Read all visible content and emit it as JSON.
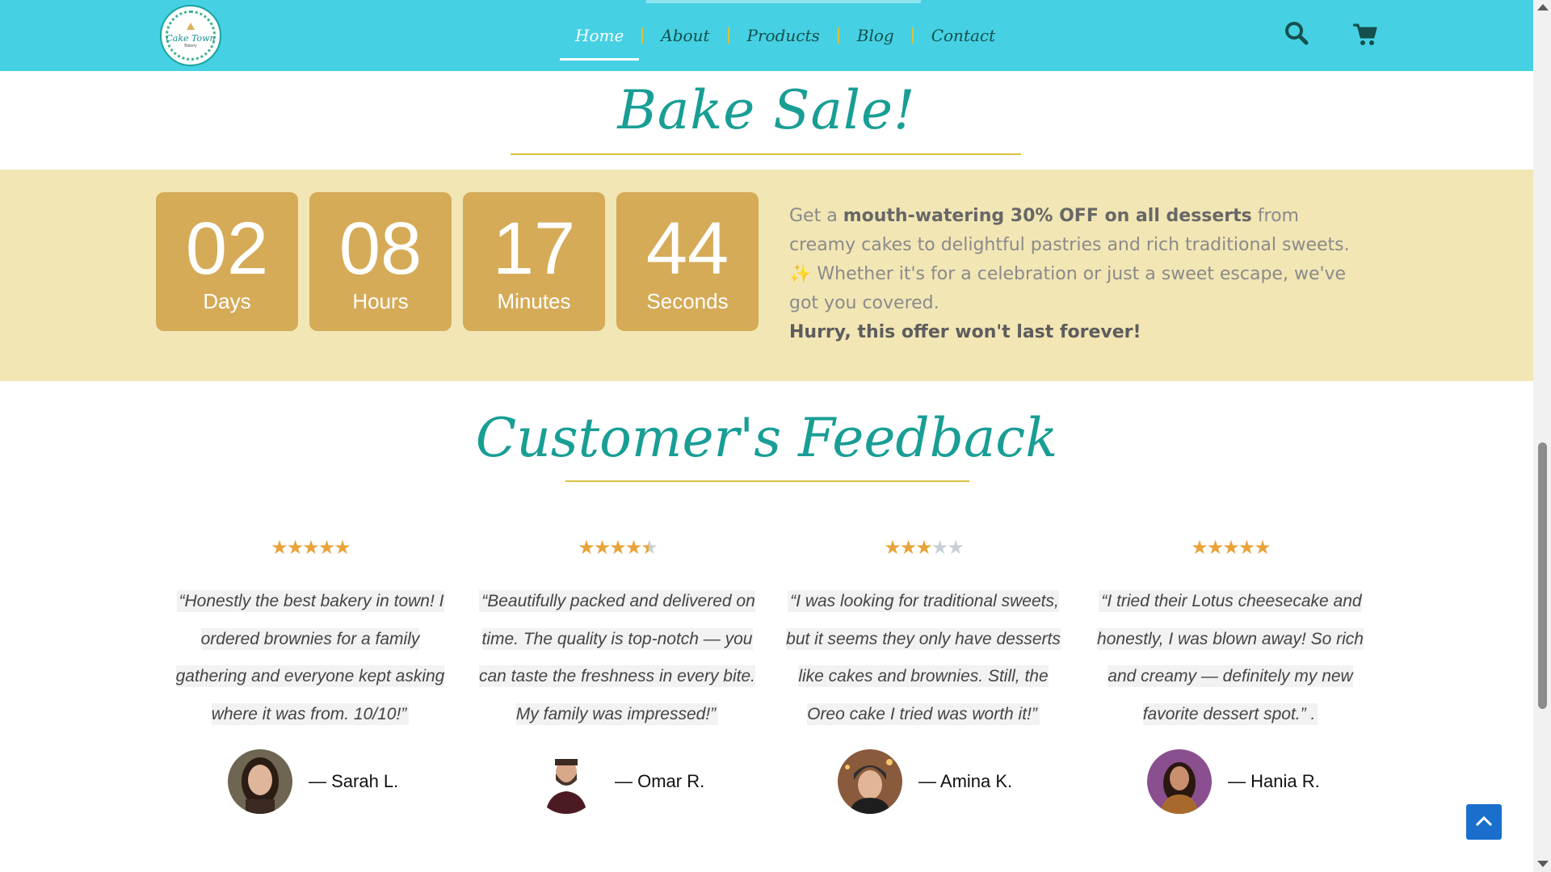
{
  "header": {
    "logo_text": "Cake Town",
    "logo_sub": "Bakery",
    "nav": [
      {
        "label": "Home"
      },
      {
        "label": "About"
      },
      {
        "label": "Products"
      },
      {
        "label": "Blog"
      },
      {
        "label": "Contact"
      }
    ],
    "active_nav": "Home",
    "icons": [
      "search-icon",
      "cart-icon"
    ]
  },
  "sale": {
    "title": "Bake Sale!",
    "countdown": [
      {
        "value": "02",
        "label": "Days"
      },
      {
        "value": "08",
        "label": "Hours"
      },
      {
        "value": "17",
        "label": "Minutes"
      },
      {
        "value": "44",
        "label": "Seconds"
      }
    ],
    "offer_prefix": "Get a ",
    "offer_bold": "mouth-watering 30% OFF on all desserts",
    "offer_mid": " from creamy cakes to delightful pastries and rich traditional sweets. ",
    "offer_sparkle": "✨",
    "offer_suffix": " Whether it's for a celebration or just a sweet escape, we've got you covered.",
    "hurry": "Hurry, this offer won't last forever!"
  },
  "feedback": {
    "title": "Customer's Feedback",
    "reviews": [
      {
        "rating": 5,
        "quote": "“Honestly the best bakery in town! I ordered brownies for a family gathering and everyone kept asking where it was from. 10/10!”",
        "author": "— Sarah L."
      },
      {
        "rating": 4.5,
        "quote": "“Beautifully packed and delivered on time. The quality is top-notch — you can taste the freshness in every bite. My family was impressed!”",
        "author": "— Omar R."
      },
      {
        "rating": 3,
        "quote": "“I was looking for traditional sweets, but it seems they only have desserts like cakes and brownies. Still, the Oreo cake I tried was worth it!”",
        "author": "— Amina K."
      },
      {
        "rating": 5,
        "quote": "“I tried their Lotus cheesecake and honestly, I was blown away! So rich and creamy — definitely my new favorite dessert spot.” .",
        "author": "— Hania R."
      }
    ]
  },
  "colors": {
    "header_bg": "#45d1e3",
    "title_teal": "#189e95",
    "countdown_band": "#f2e6b5",
    "countdown_box": "#d5ab58",
    "star": "#e7a43b",
    "scroll_top_button": "#1a6fcd"
  }
}
